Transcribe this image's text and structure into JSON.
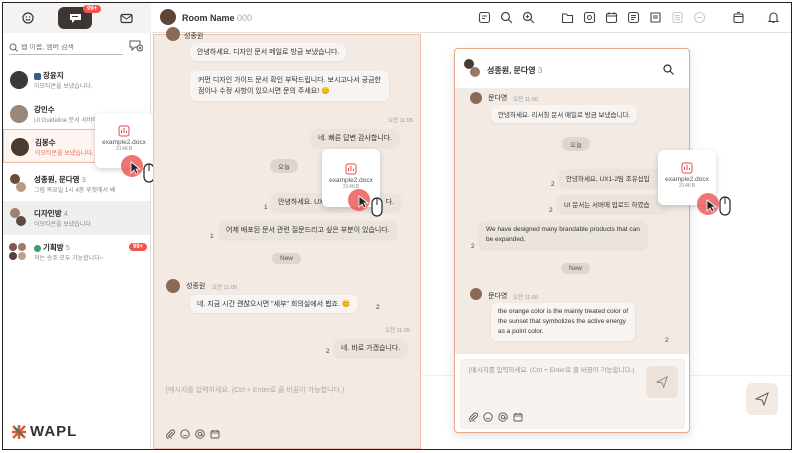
{
  "sidebar": {
    "tabs_badge": "99+",
    "search_placeholder": "웹 이름, 멤버 검색",
    "rooms": [
      {
        "name": "장윤지",
        "count": "",
        "preview": "이모티콘을 보냈습니다."
      },
      {
        "name": "강민수",
        "count": "",
        "preview": "UI Guideline 문서 서버에"
      },
      {
        "name": "김봉수",
        "count": "",
        "preview": "이모티콘을 보냈습니다."
      },
      {
        "name": "성종원, 문다영",
        "count": "3",
        "preview": "그림 목요일 1시 4층 루첫에서 봬"
      },
      {
        "name": "디자인방",
        "count": "4",
        "preview": "이모티콘을 보냈습니다."
      },
      {
        "name": "기획방",
        "count": "5",
        "preview": "저는 승주 모두 가능합니다~",
        "badge": "99+"
      }
    ],
    "logo": "WAPL"
  },
  "header": {
    "room_name": "Room Name",
    "room_count": "000"
  },
  "main_chat": {
    "top_sender": "성종원",
    "messages": [
      {
        "text": "안녕하세요. 디자인 문서 메일로 방금 보냈습니다."
      },
      {
        "text": "커먼 디자인 가이드 문서 확인 부탁드립니다. 보시고나서 궁금한"
      },
      {
        "text": "점이나 수정 사항이 있으시면 문의 주세요! 😊"
      },
      {
        "text": "네. 빠른 답변 감사합니다.",
        "time": "오전 11:05"
      },
      {
        "text": "안녕하세요. UX1",
        "tail": "다.",
        "read": "1"
      },
      {
        "text": "어제 배포된 문서 관련 질문드리고 싶은 부분이 있습니다.",
        "read": "1"
      },
      {
        "text": "네. 지금 시간 괜찮으시면 \"세부\" 회의실에서 뵙죠. 😊",
        "read": "2"
      },
      {
        "text": "네. 바로 가겠습니다.",
        "time": "오전 11:05",
        "read": "2"
      }
    ],
    "date_pill": "오늘",
    "new_pill": "New",
    "sender2": "성종원",
    "sender2_time": "오전 11:00",
    "input_placeholder": "[메시지를 입력하세요. (Ctrl + Enter로 줄 바꿈이 가능합니다.)",
    "file_card_a": {
      "name": "example2.docx",
      "size": "314KB"
    },
    "file_card_b": {
      "name": "example2.docx",
      "size": "314KB"
    }
  },
  "panel": {
    "title": "성종원, 문다영",
    "count": "3",
    "sender1": "문다영",
    "sender1_time": "오전 11:00",
    "msg1": "안녕하세요. 리서칭 문서 메일로 방금 보냈습니다.",
    "date_pill": "오늘",
    "msg2": "안녕하세요, UX1-2팀 조유섭입",
    "msg2_read": "2",
    "msg3": "UI 문서는 서버에 업로드 하였습",
    "msg3_read": "2",
    "msg4a": "We have designed many brandable products that can",
    "msg4b": "be expanded.",
    "msg4_read": "2",
    "new_pill": "New",
    "sender2": "문다영",
    "sender2_time": "오전 11:05",
    "msg5a": "the orange color is the mainly treated color of",
    "msg5b": "the sunset that symbolizes the active energy",
    "msg5c": "as a point color.",
    "msg5_read": "2",
    "input_placeholder": "[메시지를 입력하세요. (Ctrl + Enter로 줄 바꿈이 가능합니다.)",
    "file_card": {
      "name": "example2.docx",
      "size": "314KB"
    }
  },
  "colors": {
    "accent": "#f2554f",
    "chat_bg": "#f3eae3",
    "dark_tab": "#3d3633"
  }
}
